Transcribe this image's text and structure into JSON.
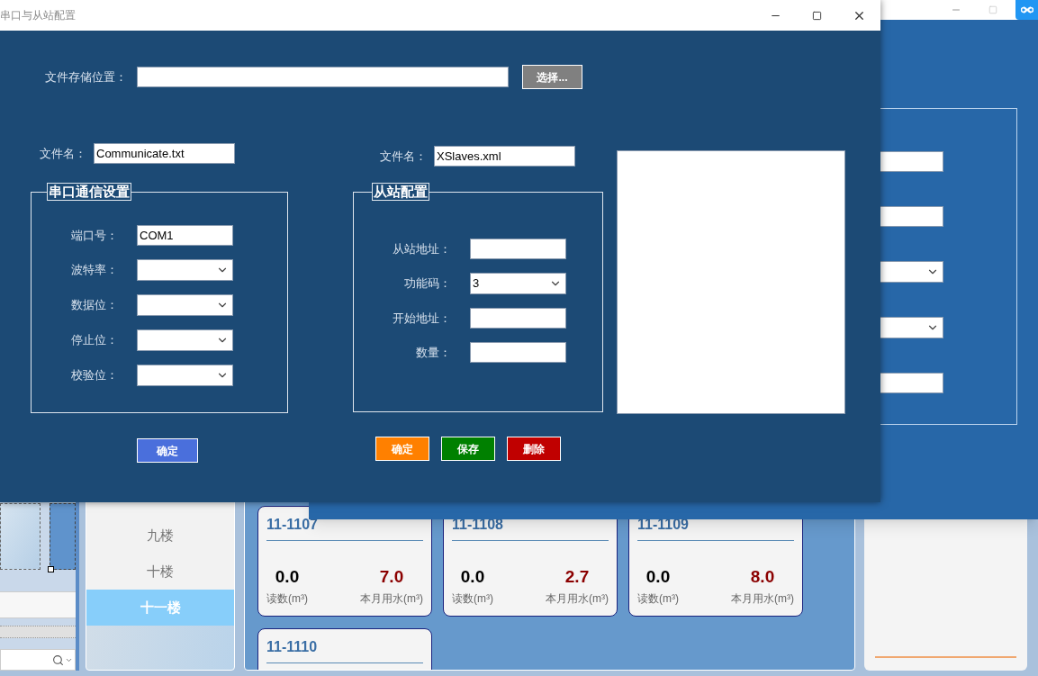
{
  "dialog": {
    "title": "串口与从站配置",
    "storage": {
      "label": "文件存储位置：",
      "button": "选择..."
    },
    "serial": {
      "file_label": "文件名：",
      "file_value": "Communicate.txt",
      "group_title": "串口通信设置",
      "fields": [
        {
          "label": "端口号：",
          "kind": "input",
          "value": "COM1"
        },
        {
          "label": "波特率：",
          "kind": "dropdown"
        },
        {
          "label": "数据位：",
          "kind": "dropdown"
        },
        {
          "label": "停止位：",
          "kind": "dropdown"
        },
        {
          "label": "校验位：",
          "kind": "dropdown"
        }
      ],
      "buttons": [
        {
          "label": "确定",
          "color": "#4a6fdc"
        }
      ]
    },
    "slave": {
      "file_label": "文件名：",
      "file_value": "XSlaves.xml",
      "group_title": "从站配置",
      "fields": [
        {
          "label": "从站地址：",
          "kind": "input"
        },
        {
          "label": "功能码：",
          "kind": "dropdown",
          "value": "3"
        },
        {
          "label": "开始地址：",
          "kind": "input"
        },
        {
          "label": "数量：",
          "kind": "input"
        }
      ],
      "buttons": [
        {
          "label": "确定",
          "color": "#ff8000"
        },
        {
          "label": "保存",
          "color": "#008000"
        },
        {
          "label": "删除",
          "color": "#c00000"
        }
      ]
    }
  },
  "back_window": {
    "fields": [
      {
        "kind": "input"
      },
      {
        "kind": "input"
      },
      {
        "kind": "dropdown"
      },
      {
        "kind": "dropdown"
      },
      {
        "kind": "input"
      }
    ]
  },
  "floors": [
    {
      "label": "九楼",
      "selected": false
    },
    {
      "label": "十楼",
      "selected": false
    },
    {
      "label": "十一楼",
      "selected": true
    }
  ],
  "meters": [
    {
      "room": "11-1107",
      "reading": "0.0",
      "reading_label": "读数(m³)",
      "usage": "7.0",
      "usage_label": "本月用水(m³)"
    },
    {
      "room": "11-1108",
      "reading": "0.0",
      "reading_label": "读数(m³)",
      "usage": "2.7",
      "usage_label": "本月用水(m³)"
    },
    {
      "room": "11-1109",
      "reading": "0.0",
      "reading_label": "读数(m³)",
      "usage": "8.0",
      "usage_label": "本月用水(m³)"
    },
    {
      "room": "11-1110"
    }
  ]
}
